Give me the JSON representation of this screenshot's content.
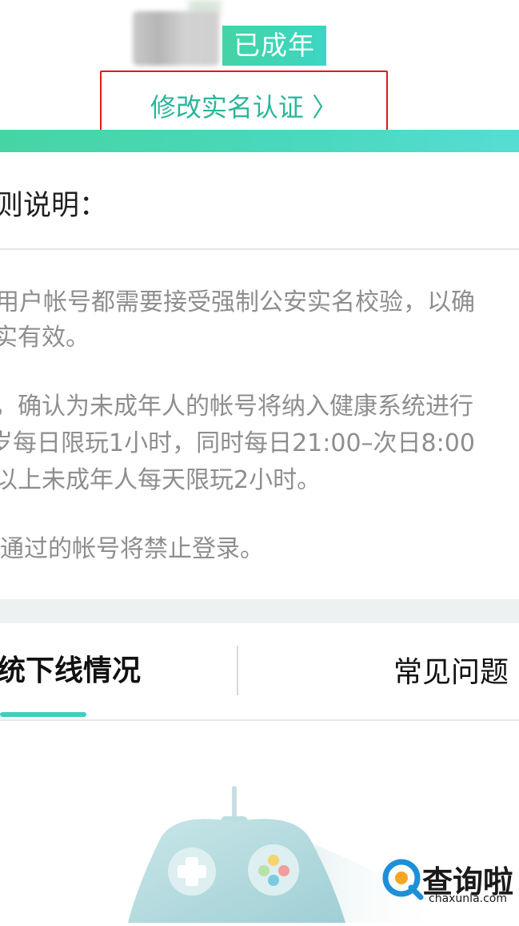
{
  "profile": {
    "status_badge": "已成年",
    "modify_link": "修改实名认证 〉"
  },
  "rules": {
    "title": "则说明：",
    "lines": [
      "用户帐号都需要接受强制公安实名校验，以确",
      "实有效。",
      "，确认为未成年人的帐号将纳入健康系统进行",
      "岁每日限玩1小时，同时每日21:00–次日8:00",
      "以上未成年人每天限玩2小时。",
      "通过的帐号将禁止登录。"
    ]
  },
  "tabs": {
    "left_label": "统下线情况",
    "right_label": "常见问题"
  },
  "watermark": {
    "title": "查询啦",
    "domain": "chaxunla.com"
  },
  "colors": {
    "accent": "#44d3a4",
    "link": "#2db59b",
    "highlight_box": "#e11a20"
  }
}
